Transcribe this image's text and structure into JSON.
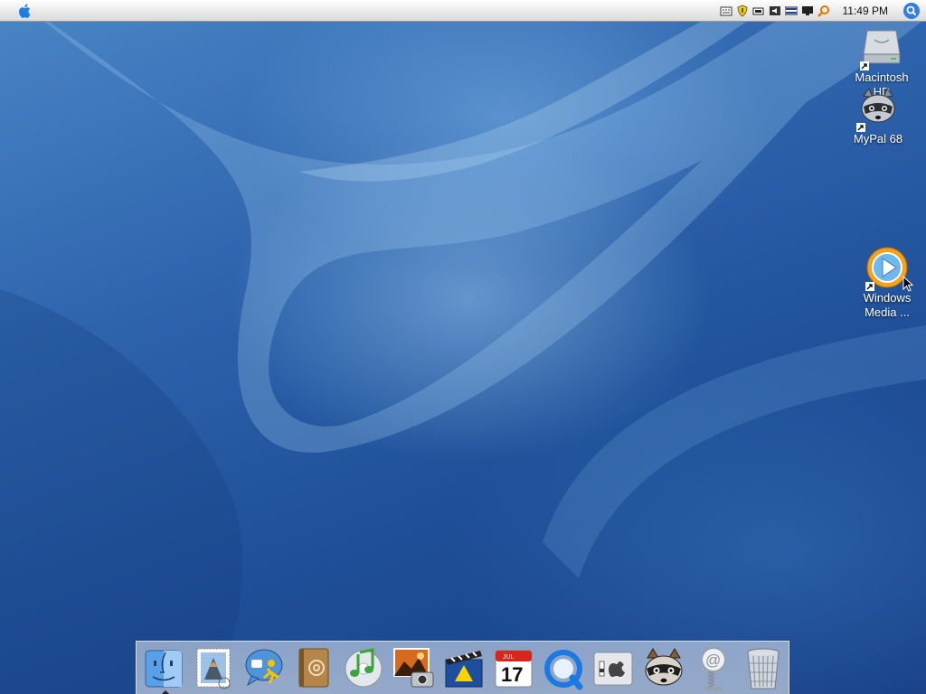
{
  "menubar": {
    "clock": "11:49 PM",
    "tray_icons": [
      "keyboard-icon",
      "shield-icon",
      "battery-icon",
      "volume-icon",
      "network-icon",
      "display-icon",
      "search-tray-icon"
    ],
    "spotlight_icon": "spotlight-icon",
    "apple_icon": "apple-icon"
  },
  "desktop_icons": [
    {
      "label": "Macintosh\nHD",
      "icon": "hard-drive-icon"
    },
    {
      "label": "MyPal 68",
      "icon": "raccoon-icon"
    },
    {
      "label": "Windows\nMedia ...",
      "icon": "media-player-icon"
    }
  ],
  "dock": {
    "items": [
      {
        "name": "finder",
        "icon": "finder-icon",
        "running": true
      },
      {
        "name": "mail",
        "icon": "mail-stamp-icon",
        "running": false
      },
      {
        "name": "ichat",
        "icon": "ichat-icon",
        "running": false
      },
      {
        "name": "address-book",
        "icon": "address-book-icon",
        "running": false
      },
      {
        "name": "itunes",
        "icon": "itunes-icon",
        "running": false
      },
      {
        "name": "iphoto",
        "icon": "iphoto-icon",
        "running": false
      },
      {
        "name": "imovie",
        "icon": "imovie-icon",
        "running": false
      },
      {
        "name": "ical",
        "icon": "ical-icon",
        "running": false,
        "month": "JUL",
        "day": "17"
      },
      {
        "name": "quicktime",
        "icon": "quicktime-icon",
        "running": false
      },
      {
        "name": "system-preferences",
        "icon": "system-preferences-icon",
        "running": false
      },
      {
        "name": "mypal",
        "icon": "raccoon-icon",
        "running": false
      },
      {
        "name": "mail-spring",
        "icon": "at-spring-icon",
        "running": false
      },
      {
        "name": "trash",
        "icon": "trash-icon",
        "running": false
      }
    ]
  },
  "colors": {
    "wallpaper_light": "#7fb2e0",
    "wallpaper_dark": "#173f86",
    "menubar": "#e8e8e8",
    "spotlight": "#2f7fe0"
  }
}
